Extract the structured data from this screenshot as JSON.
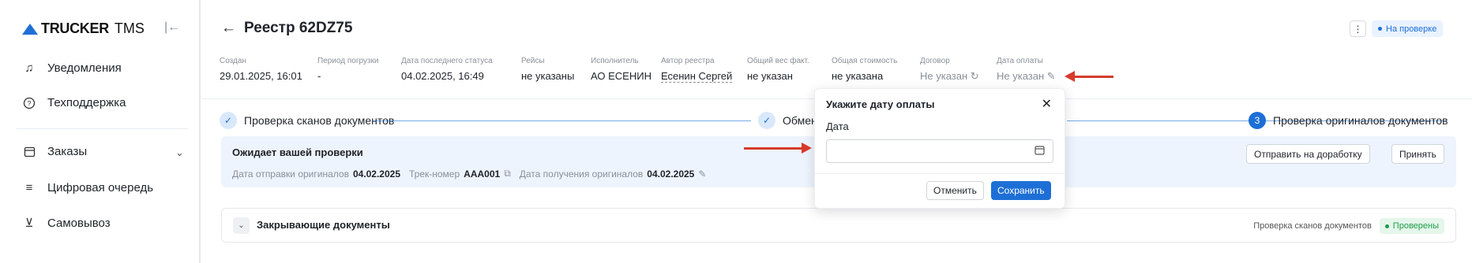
{
  "logo": {
    "brand_bold": "TRUCKER",
    "brand_light": "TMS"
  },
  "sidebar": {
    "items": [
      {
        "label": "Уведомления",
        "icon": "bell-icon"
      },
      {
        "label": "Техподдержка",
        "icon": "help-circle-icon"
      },
      {
        "label": "Заказы",
        "icon": "calendar-icon"
      },
      {
        "label": "Цифровая очередь",
        "icon": "queue-icon"
      },
      {
        "label": "Самовывоз",
        "icon": "pickup-icon"
      }
    ]
  },
  "header": {
    "title": "Реестр 62DZ75",
    "status": "На проверке"
  },
  "meta": [
    {
      "label": "Создан",
      "value": "29.01.2025, 16:01"
    },
    {
      "label": "Период погрузки",
      "value": "-"
    },
    {
      "label": "Дата последнего статуса",
      "value": "04.02.2025, 16:49"
    },
    {
      "label": "Рейсы",
      "value": "не указаны"
    },
    {
      "label": "Исполнитель",
      "value": "АО ЕСЕНИН"
    },
    {
      "label": "Автор реестра",
      "value": "Есенин Сергей"
    },
    {
      "label": "Общий вес факт.",
      "value": "не указан"
    },
    {
      "label": "Общая стоимость",
      "value": "не указана"
    },
    {
      "label": "Договор",
      "value": "Не указан"
    },
    {
      "label": "Дата оплаты",
      "value": "Не указан"
    }
  ],
  "steps": [
    {
      "label": "Проверка сканов документов"
    },
    {
      "label": "Обмен"
    },
    {
      "label": "Проверка оригиналов документов",
      "number": "3"
    }
  ],
  "review": {
    "title": "Ожидает вашей проверки",
    "sent_label": "Дата отправки оригиналов",
    "sent_value": "04.02.2025",
    "track_label": "Трек-номер",
    "track_value": "AAA001",
    "received_label": "Дата получения оригиналов",
    "received_value": "04.02.2025",
    "btn_return": "Отправить на доработку",
    "btn_accept": "Принять"
  },
  "closing": {
    "title": "Закрывающие документы",
    "stage": "Проверка сканов документов",
    "status": "Проверены"
  },
  "popup": {
    "title": "Укажите дату оплаты",
    "field_label": "Дата",
    "cancel": "Отменить",
    "save": "Сохранить"
  },
  "colors": {
    "accent": "#1d6fd6",
    "arrow": "#d63a2b",
    "success": "#1e9c4a"
  }
}
